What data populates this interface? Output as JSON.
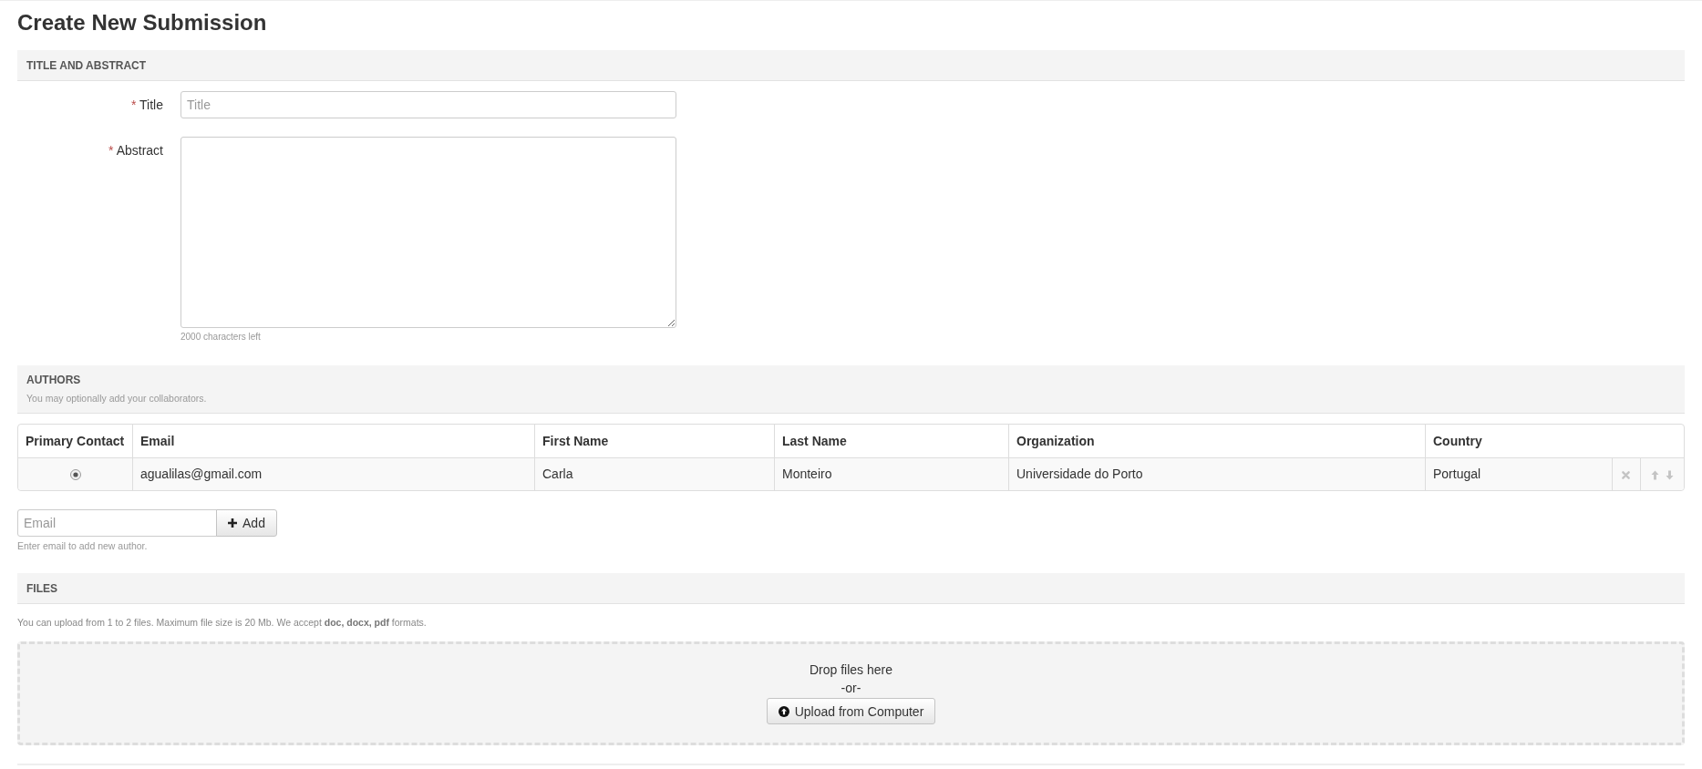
{
  "page": {
    "title": "Create New Submission"
  },
  "title_and_abstract": {
    "heading": "TITLE AND ABSTRACT",
    "fields": [
      {
        "kind": "text",
        "required_mark": "*",
        "label": "Title",
        "placeholder": "Title"
      },
      {
        "kind": "textarea",
        "required_mark": "*",
        "label": "Abstract",
        "counter": "2000 characters left"
      }
    ]
  },
  "authors": {
    "heading": "AUTHORS",
    "subheading": "You may optionally add your collaborators.",
    "columns": [
      "Primary Contact",
      "Email",
      "First Name",
      "Last Name",
      "Organization",
      "Country"
    ],
    "rows": [
      {
        "primary_contact": true,
        "email": "agualilas@gmail.com",
        "first_name": "Carla",
        "last_name": "Monteiro",
        "organization": "Universidade do Porto",
        "country": "Portugal"
      }
    ],
    "add_author": {
      "placeholder": "Email",
      "button": "Add",
      "hint": "Enter email to add new author."
    }
  },
  "files": {
    "heading": "FILES",
    "note": "You can upload from 1 to 2 files. Maximum file size is 20 Mb. We accept **doc, docx, pdf** formats.",
    "dropzone": {
      "text": "Drop files here",
      "separator": "-or-",
      "button": "Upload from Computer"
    }
  }
}
